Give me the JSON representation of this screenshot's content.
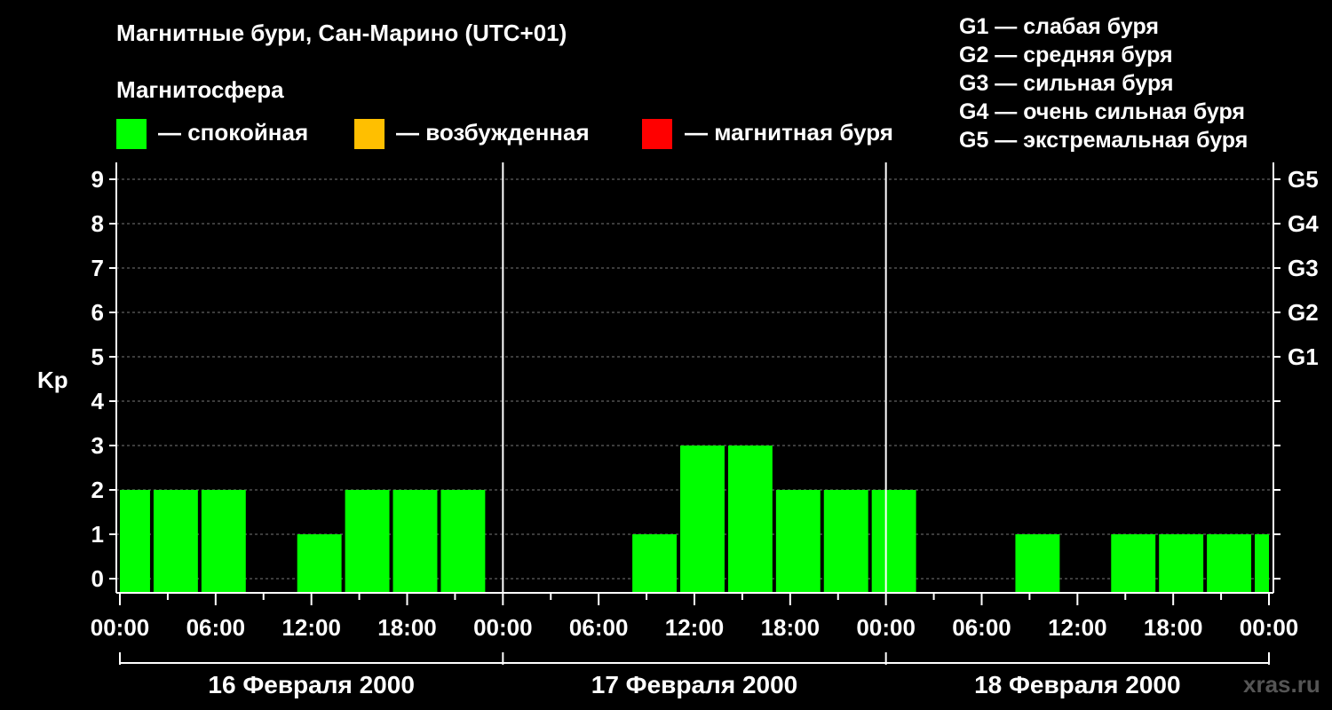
{
  "title": "Магнитные бури, Сан-Марино (UTC+01)",
  "legend": {
    "title": "Магнитосфера",
    "items": [
      {
        "label": "— спокойная",
        "color": "#00ff00"
      },
      {
        "label": "— возбужденная",
        "color": "#ffbf00"
      },
      {
        "label": "— магнитная буря",
        "color": "#ff0000"
      }
    ]
  },
  "g_scale": [
    "G1 — слабая буря",
    "G2 — средняя буря",
    "G3 — сильная буря",
    "G4 — очень сильная буря",
    "G5 — экстремальная буря"
  ],
  "watermark": "xras.ru",
  "chart_data": {
    "type": "bar",
    "ylabel": "Kp",
    "ylim": [
      0,
      9
    ],
    "yticks": [
      "0",
      "1",
      "2",
      "3",
      "4",
      "5",
      "6",
      "7",
      "8",
      "9"
    ],
    "right_ticks": [
      {
        "kp": 5,
        "label": "G1"
      },
      {
        "kp": 6,
        "label": "G2"
      },
      {
        "kp": 7,
        "label": "G3"
      },
      {
        "kp": 8,
        "label": "G4"
      },
      {
        "kp": 9,
        "label": "G5"
      }
    ],
    "grid": "dashed horizontal",
    "xtick_labels": [
      "00:00",
      "06:00",
      "12:00",
      "18:00",
      "00:00",
      "06:00",
      "12:00",
      "18:00",
      "00:00",
      "06:00",
      "12:00",
      "18:00",
      "00:00"
    ],
    "days": [
      "16 Февраля 2000",
      "17 Февраля 2000",
      "18 Февраля 2000"
    ],
    "x_unit": "hours from 16 Feb 2000 00:00 (UTC+01)",
    "bars": [
      {
        "start": 0,
        "end": 2,
        "kp": 2,
        "color": "#00ff00"
      },
      {
        "start": 2,
        "end": 5,
        "kp": 2,
        "color": "#00ff00"
      },
      {
        "start": 5,
        "end": 8,
        "kp": 2,
        "color": "#00ff00"
      },
      {
        "start": 8,
        "end": 11,
        "kp": 0,
        "color": "#00ff00"
      },
      {
        "start": 11,
        "end": 14,
        "kp": 1,
        "color": "#00ff00"
      },
      {
        "start": 14,
        "end": 17,
        "kp": 2,
        "color": "#00ff00"
      },
      {
        "start": 17,
        "end": 20,
        "kp": 2,
        "color": "#00ff00"
      },
      {
        "start": 20,
        "end": 23,
        "kp": 2,
        "color": "#00ff00"
      },
      {
        "start": 23,
        "end": 26,
        "kp": 0,
        "color": "#00ff00"
      },
      {
        "start": 26,
        "end": 29,
        "kp": 0,
        "color": "#00ff00"
      },
      {
        "start": 29,
        "end": 32,
        "kp": 0,
        "color": "#00ff00"
      },
      {
        "start": 32,
        "end": 35,
        "kp": 1,
        "color": "#00ff00"
      },
      {
        "start": 35,
        "end": 38,
        "kp": 3,
        "color": "#00ff00"
      },
      {
        "start": 38,
        "end": 41,
        "kp": 3,
        "color": "#00ff00"
      },
      {
        "start": 41,
        "end": 44,
        "kp": 2,
        "color": "#00ff00"
      },
      {
        "start": 44,
        "end": 47,
        "kp": 2,
        "color": "#00ff00"
      },
      {
        "start": 47,
        "end": 50,
        "kp": 2,
        "color": "#00ff00"
      },
      {
        "start": 50,
        "end": 53,
        "kp": 0,
        "color": "#00ff00"
      },
      {
        "start": 53,
        "end": 56,
        "kp": 0,
        "color": "#00ff00"
      },
      {
        "start": 56,
        "end": 59,
        "kp": 1,
        "color": "#00ff00"
      },
      {
        "start": 59,
        "end": 62,
        "kp": 0,
        "color": "#00ff00"
      },
      {
        "start": 62,
        "end": 65,
        "kp": 1,
        "color": "#00ff00"
      },
      {
        "start": 65,
        "end": 68,
        "kp": 1,
        "color": "#00ff00"
      },
      {
        "start": 68,
        "end": 71,
        "kp": 1,
        "color": "#00ff00"
      },
      {
        "start": 71,
        "end": 72,
        "kp": 1,
        "color": "#00ff00"
      }
    ]
  }
}
